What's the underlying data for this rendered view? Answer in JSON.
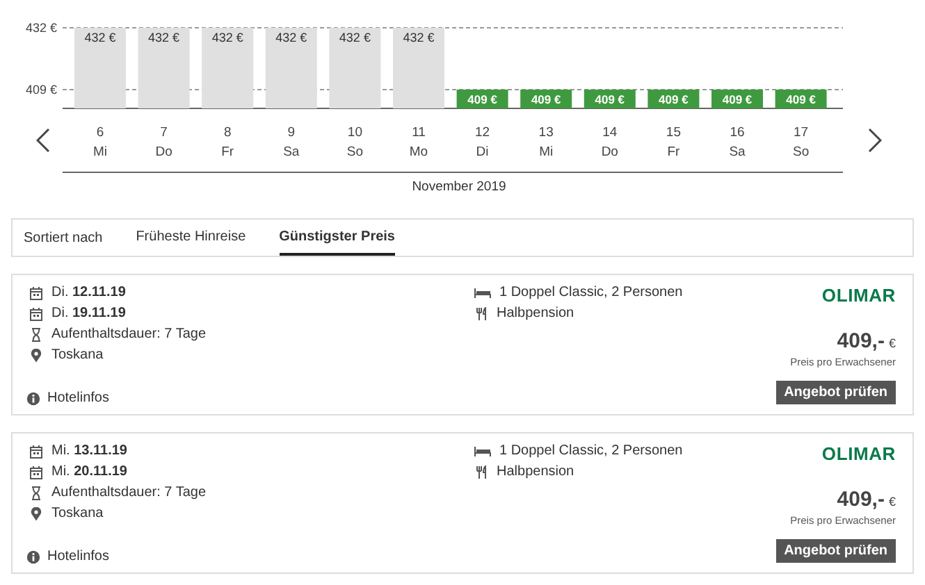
{
  "chart": {
    "weekdays": [
      "Mi",
      "Do",
      "Fr",
      "Sa",
      "So",
      "Mo",
      "Di",
      "Mi",
      "Do",
      "Fr",
      "Sa",
      "So"
    ],
    "month_label": "November 2019",
    "chart_data": {
      "type": "bar",
      "categories": [
        "6",
        "7",
        "8",
        "9",
        "10",
        "11",
        "12",
        "13",
        "14",
        "15",
        "16",
        "17"
      ],
      "series": [
        {
          "color": "#e0e0e0",
          "values": [
            432,
            432,
            432,
            432,
            432,
            432,
            null,
            null,
            null,
            null,
            null,
            null
          ]
        },
        {
          "color": "#3f9a3f",
          "values": [
            null,
            null,
            null,
            null,
            null,
            null,
            409,
            409,
            409,
            409,
            409,
            409
          ]
        }
      ],
      "ylim": [
        402,
        432
      ],
      "yticks": [
        {
          "value": 409,
          "label": "409 €"
        },
        {
          "value": 432,
          "label": "432 €"
        }
      ],
      "value_labels": [
        "432 €",
        "432 €",
        "432 €",
        "432 €",
        "432 €",
        "432 €",
        "409 €",
        "409 €",
        "409 €",
        "409 €",
        "409 €",
        "409 €"
      ]
    }
  },
  "sort": {
    "label": "Sortiert nach",
    "options": [
      {
        "label": "Früheste Hinreise",
        "selected": false
      },
      {
        "label": "Günstigster Preis",
        "selected": true
      }
    ]
  },
  "offers": [
    {
      "departure": "Di. **12.11.19**",
      "return": "Di. **19.11.19**",
      "duration": "Aufenthaltsdauer: 7 Tage",
      "region": "Toskana",
      "room": "1 Doppel Classic, 2 Personen",
      "board": "Halbpension",
      "operator": "OLIMAR",
      "price": "409,-",
      "currency": "€",
      "price_note": "Preis pro Erwachsener",
      "button": "Angebot prüfen",
      "info_link": "Hotelinfos"
    },
    {
      "departure": "Mi. **13.11.19**",
      "return": "Mi. **20.11.19**",
      "duration": "Aufenthaltsdauer: 7 Tage",
      "region": "Toskana",
      "room": "1 Doppel Classic, 2 Personen",
      "board": "Halbpension",
      "operator": "OLIMAR",
      "price": "409,-",
      "currency": "€",
      "price_note": "Preis pro Erwachsener",
      "button": "Angebot prüfen",
      "info_link": "Hotelinfos"
    }
  ]
}
